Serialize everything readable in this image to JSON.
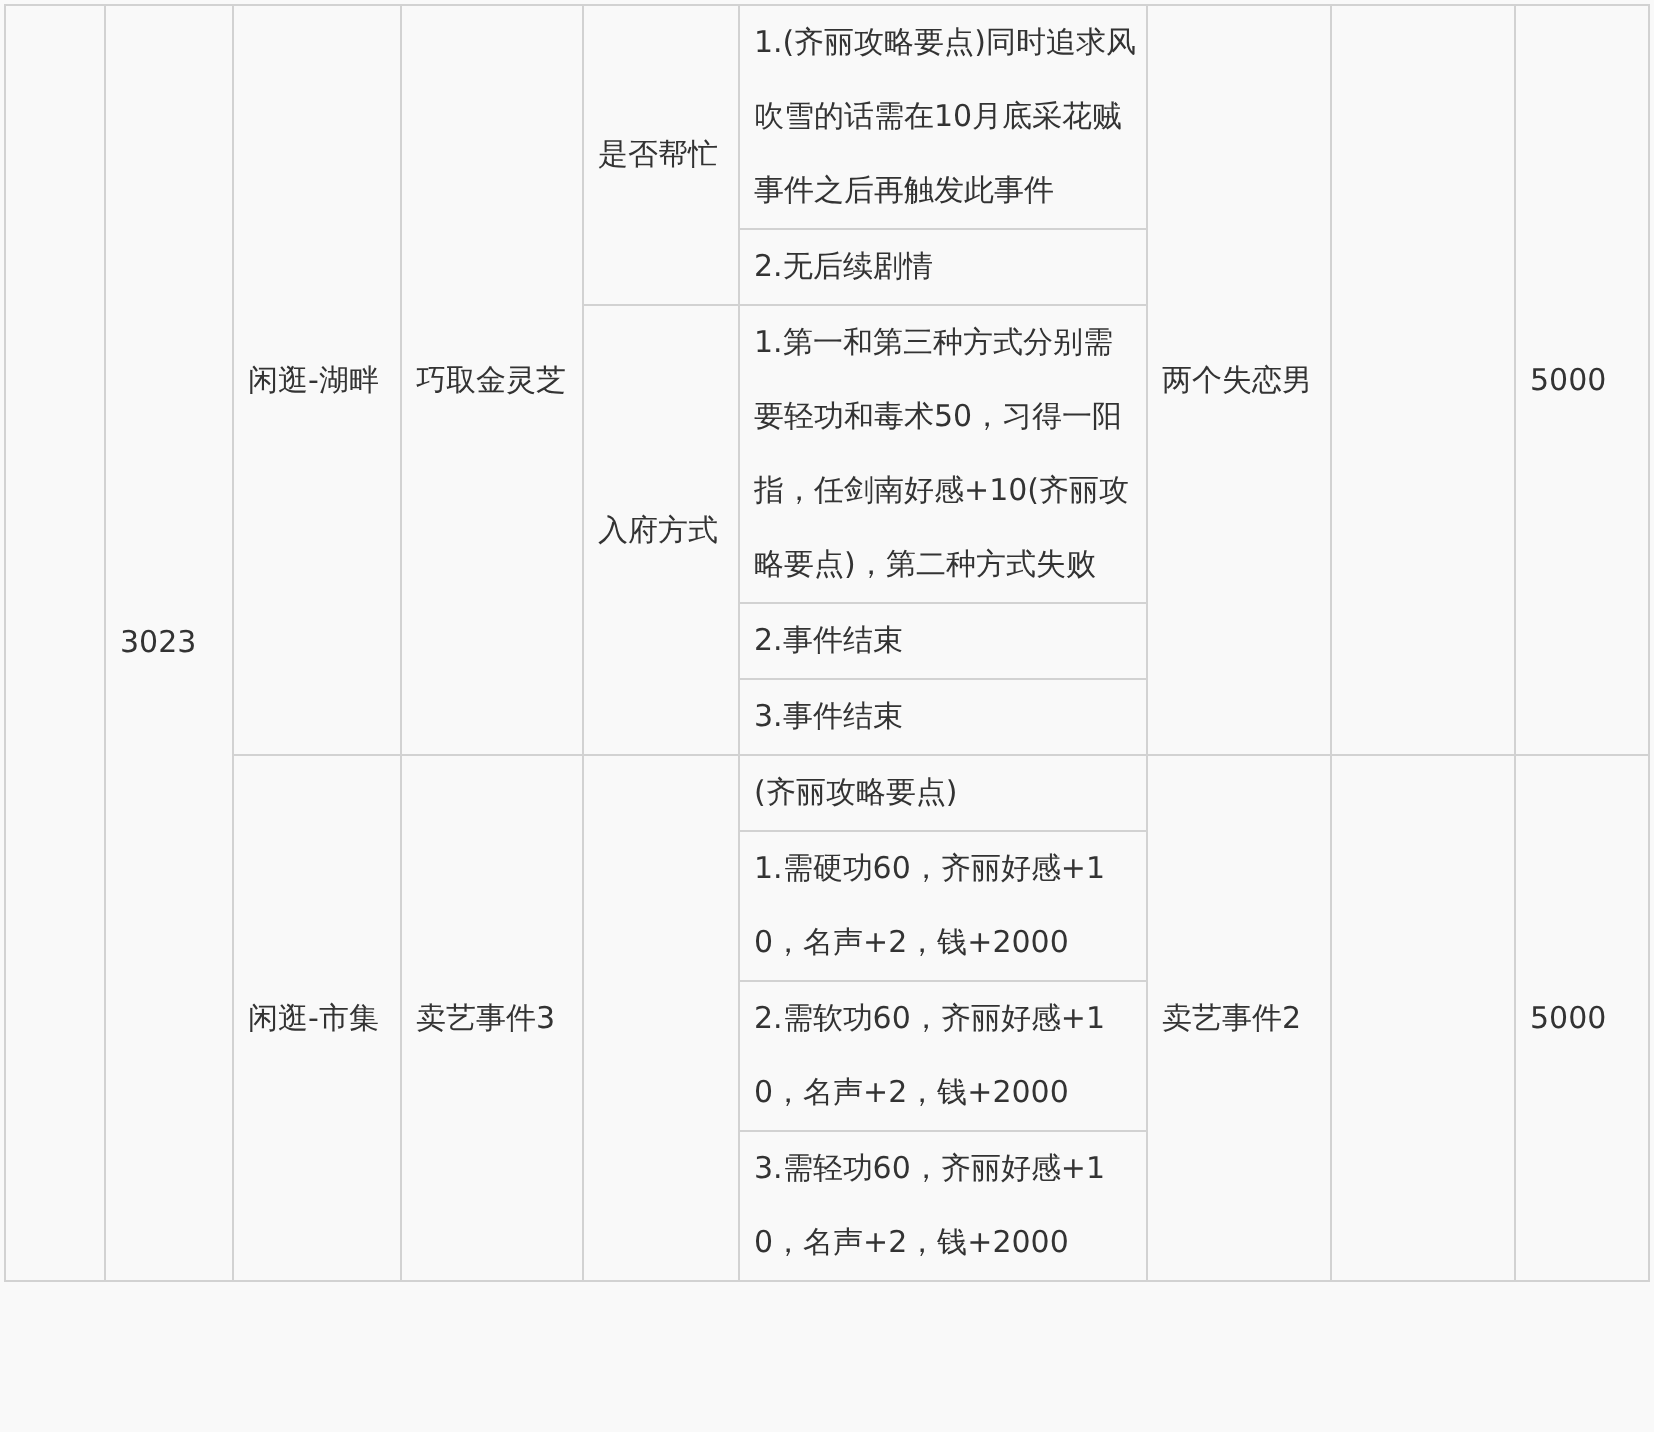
{
  "table": {
    "column_2": "3023",
    "events": [
      {
        "column_3": "闲逛-湖畔",
        "column_4": "巧取金灵芝",
        "branches": [
          {
            "column_5": "是否帮忙",
            "column_6": [
              "1.(齐丽攻略要点)同时追求风吹雪的话需在10月底采花贼事件之后再触发此事件",
              "2.无后续剧情"
            ]
          },
          {
            "column_5": "入府方式",
            "column_6": [
              "1.第一和第三种方式分别需要轻功和毒术50，习得一阳指，任剑南好感+10(齐丽攻略要点)，第二种方式失败",
              "2.事件结束",
              "3.事件结束"
            ]
          }
        ],
        "column_7": "两个失恋男",
        "column_9": "5000"
      },
      {
        "column_3": "闲逛-市集",
        "column_4": "卖艺事件3",
        "branches": [
          {
            "column_6": [
              "(齐丽攻略要点)",
              "1.需硬功60，齐丽好感+10，名声+2，钱+2000",
              "2.需软功60，齐丽好感+10，名声+2，钱+2000",
              "3.需轻功60，齐丽好感+10，名声+2，钱+2000"
            ]
          }
        ],
        "column_7": "卖艺事件2",
        "column_9": "5000"
      }
    ]
  }
}
